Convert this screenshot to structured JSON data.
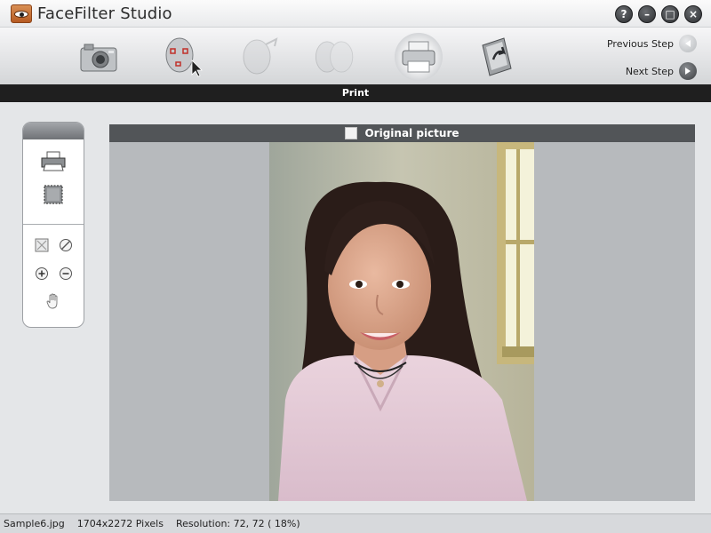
{
  "window": {
    "title": "FaceFilter Studio",
    "controls": [
      "?",
      "–",
      "□",
      "×"
    ]
  },
  "toolbar": {
    "steps": [
      {
        "icon": "camera-icon",
        "state": "enabled"
      },
      {
        "icon": "face-select-icon",
        "state": "enabled"
      },
      {
        "icon": "face-edit-icon",
        "state": "disabled"
      },
      {
        "icon": "face-compare-icon",
        "state": "disabled"
      },
      {
        "icon": "printer-icon",
        "state": "active"
      },
      {
        "icon": "exit-folder-icon",
        "state": "enabled"
      }
    ],
    "previous_step": "Previous Step",
    "next_step": "Next Step"
  },
  "step_bar": {
    "title": "Print"
  },
  "tools": [
    "print-settings-icon",
    "crop-frame-icon",
    "fit-window-icon",
    "actual-size-icon",
    "zoom-in-icon",
    "zoom-out-icon",
    "hand-pan-icon"
  ],
  "viewer": {
    "header_label": "Original picture",
    "checkbox_checked": false
  },
  "status": {
    "filename": "Sample6.jpg",
    "dimensions": "1704x2272 Pixels",
    "resolution": "Resolution: 72, 72 ( 18%)"
  }
}
